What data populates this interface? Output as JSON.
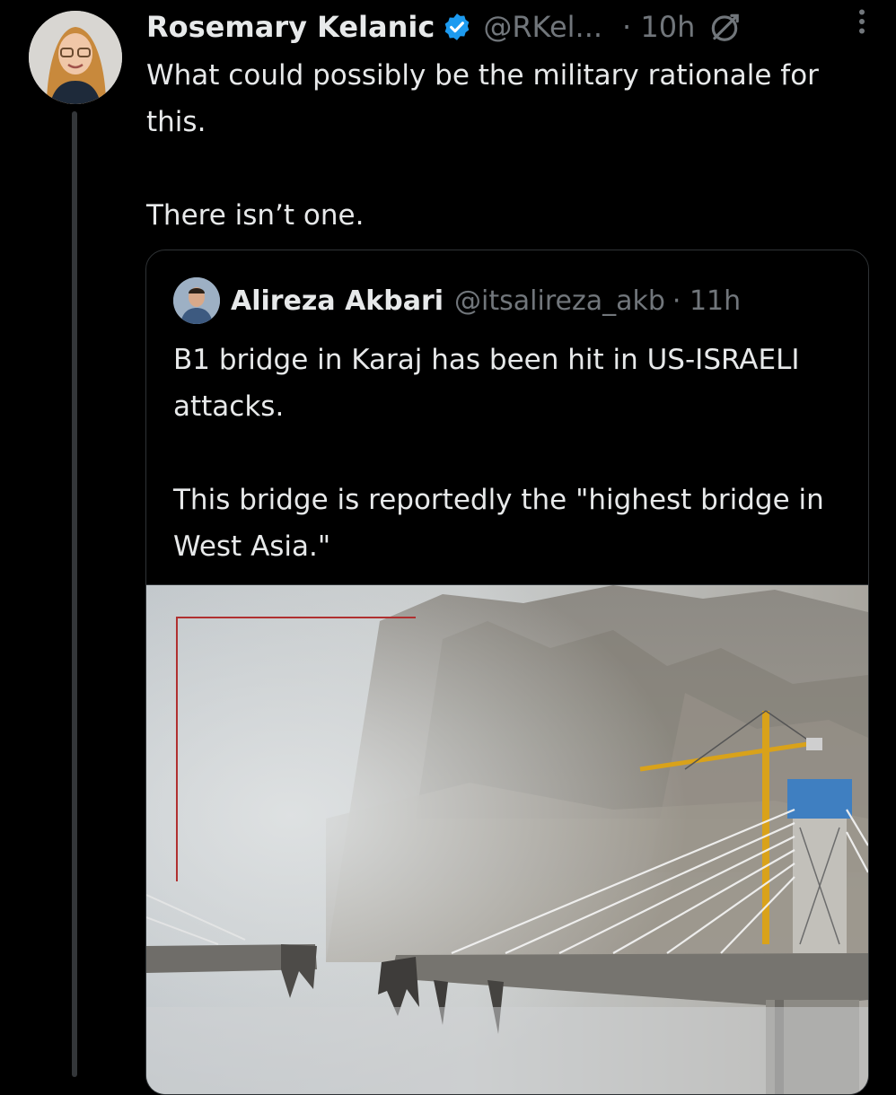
{
  "tweet": {
    "author_name": "Rosemary Kelanic",
    "handle": "@RKel...",
    "time": "· 10h",
    "paragraphs": [
      "What could possibly be the military rationale for this.",
      "There isn’t one."
    ]
  },
  "quoted": {
    "author_name": "Alireza Akbari",
    "handle": "@itsalireza_akb",
    "time": "· 11h",
    "paragraphs": [
      "B1 bridge in Karaj has been hit in US-ISRAELI attacks.",
      "This bridge is reportedly the \"highest bridge in West Asia.\""
    ]
  },
  "icons": {
    "verified": "verified-badge-icon",
    "globe": "globe-icon",
    "more": "more-vertical-icon"
  },
  "colors": {
    "background": "#000000",
    "text": "#e7e9ea",
    "muted": "#71767b",
    "border": "#2f3336",
    "verified": "#1d9bf0"
  }
}
